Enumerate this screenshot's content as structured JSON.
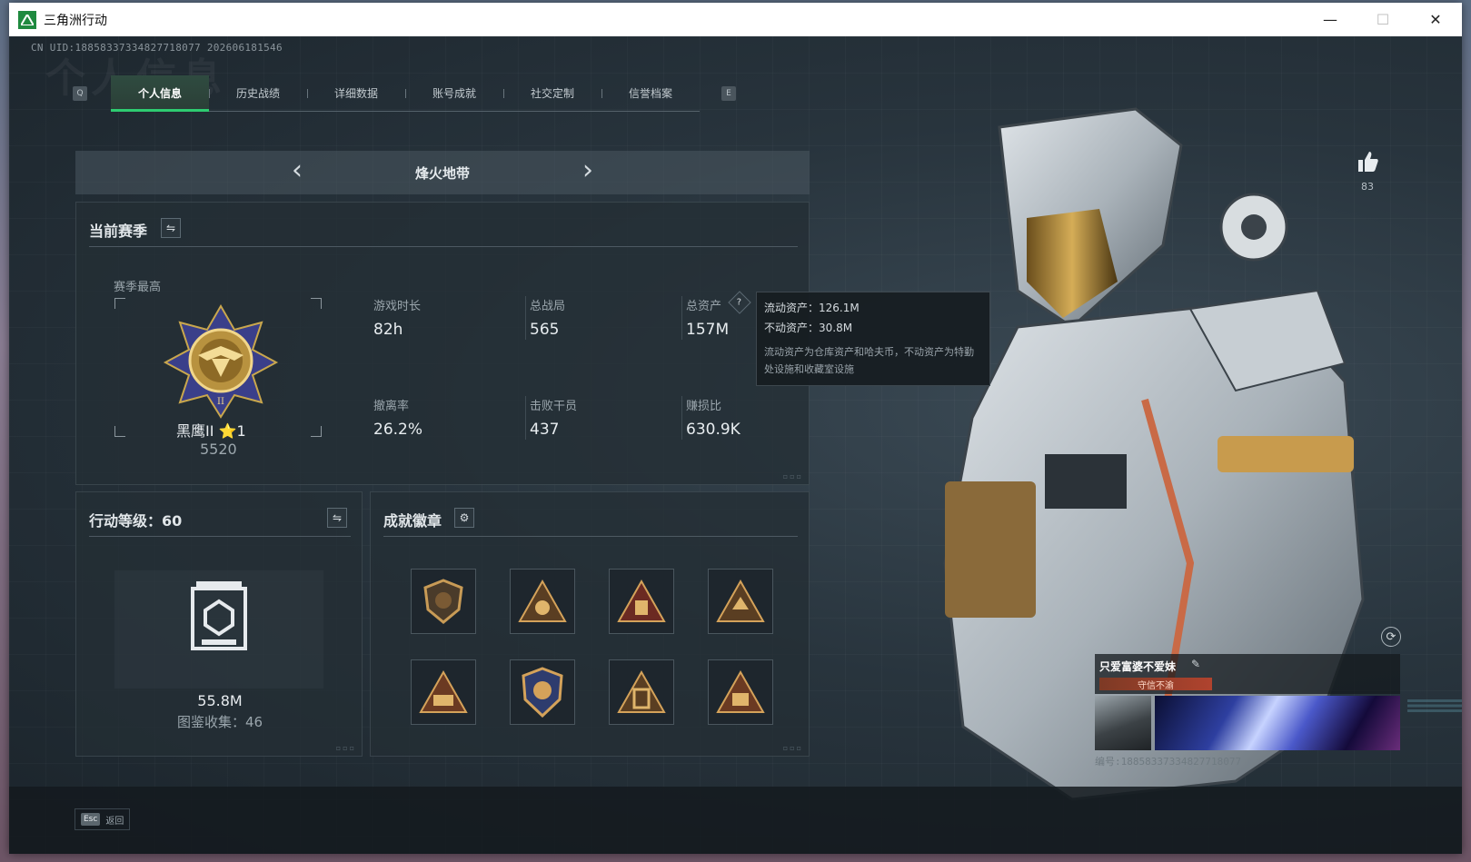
{
  "window": {
    "title": "三角洲行动",
    "controls": {
      "minimize": "—",
      "maximize": "☐",
      "close": "✕"
    }
  },
  "header": {
    "uid_line": "CN UID:18858337334827718077 202606181546",
    "ghost_title": "个人信息"
  },
  "tabs": {
    "left_key": "Q",
    "right_key": "E",
    "items": [
      {
        "label": "个人信息",
        "active": true
      },
      {
        "label": "历史战绩",
        "active": false
      },
      {
        "label": "详细数据",
        "active": false
      },
      {
        "label": "账号成就",
        "active": false
      },
      {
        "label": "社交定制",
        "active": false
      },
      {
        "label": "信誉档案",
        "active": false
      }
    ]
  },
  "mode_selector": {
    "prev": "‹",
    "next": "›",
    "name": "烽火地带"
  },
  "season": {
    "title": "当前赛季",
    "swap_icon": "⇋",
    "best_label": "赛季最高",
    "rank_name": "黑鹰II ⭐1",
    "rank_score": "5520",
    "stats": [
      {
        "label": "游戏时长",
        "value": "82h"
      },
      {
        "label": "总战局",
        "value": "565"
      },
      {
        "label": "总资产",
        "value": "157M"
      },
      {
        "label": "撤离率",
        "value": "26.2%"
      },
      {
        "label": "击败干员",
        "value": "437"
      },
      {
        "label": "赚损比",
        "value": "630.9K"
      }
    ],
    "help_icon": "?"
  },
  "tooltip": {
    "liquid": "流动资产：126.1M",
    "fixed": "不动资产：30.8M",
    "desc": "流动资产为仓库资产和哈夫币，不动资产为特勤处设施和收藏室设施"
  },
  "level": {
    "title": "行动等级：60",
    "swap_icon": "⇋",
    "value": "55.8M",
    "collection": "图鉴收集：46"
  },
  "badges": {
    "title": "成就徽章",
    "gear_icon": "⚙",
    "items": [
      "badge-1",
      "badge-2",
      "badge-3",
      "badge-4",
      "badge-5",
      "badge-6",
      "badge-7",
      "badge-8"
    ]
  },
  "social": {
    "like_count": "83",
    "refresh_icon": "⟳"
  },
  "player_card": {
    "name": "只爱富婆不爱妹",
    "edit_icon": "✎",
    "tag": "守信不渝",
    "id_line": "编号:18858337334827718077"
  },
  "footer": {
    "esc_key": "Esc",
    "esc_label": "返回"
  },
  "colors": {
    "accent": "#2ecc71",
    "panel_bg": "#242e35",
    "tag": "#b0432e"
  }
}
